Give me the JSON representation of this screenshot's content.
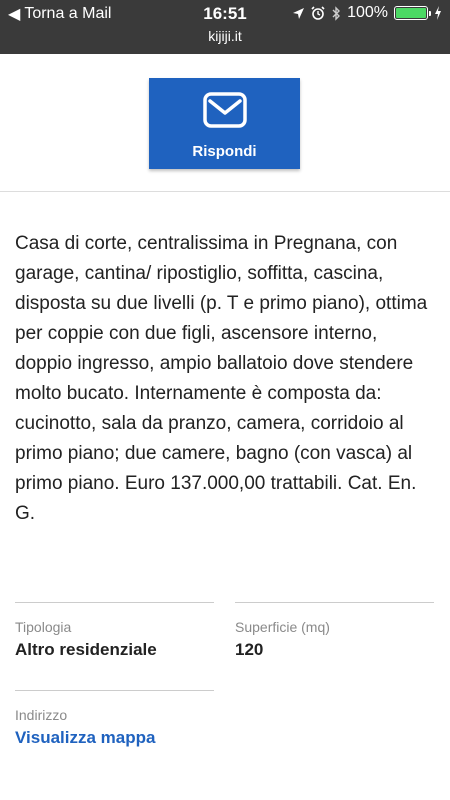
{
  "status_bar": {
    "back_label": "Torna a Mail",
    "time": "16:51",
    "battery_percent": "100%",
    "battery_level": 1.0,
    "url": "kijiji.it",
    "icons": [
      "location-arrow-icon",
      "alarm-icon",
      "bluetooth-icon",
      "battery-icon",
      "charging-icon"
    ]
  },
  "reply": {
    "label": "Rispondi",
    "icon": "envelope-icon"
  },
  "description": "Casa di corte, centralissima in Pregnana, con garage, cantina/ ripostiglio, soffitta, cascina, disposta su due livelli (p. T e primo piano), ottima per coppie con due figli, ascensore interno, doppio ingresso, ampio ballatoio dove stendere molto bucato. Internamente è composta da: cucinotto, sala da pranzo, camera, corridoio al primo piano; due camere, bagno (con vasca) al primo piano. Euro 137.000,00 trattabili. Cat. En. G.",
  "details": {
    "tipologia": {
      "label": "Tipologia",
      "value": "Altro residenziale"
    },
    "superficie": {
      "label": "Superficie (mq)",
      "value": "120"
    },
    "indirizzo": {
      "label": "Indirizzo",
      "link": "Visualizza mappa"
    }
  },
  "colors": {
    "accent": "#1f62bf",
    "status_bar": "#3a3a3a",
    "battery_green": "#4cd964"
  }
}
